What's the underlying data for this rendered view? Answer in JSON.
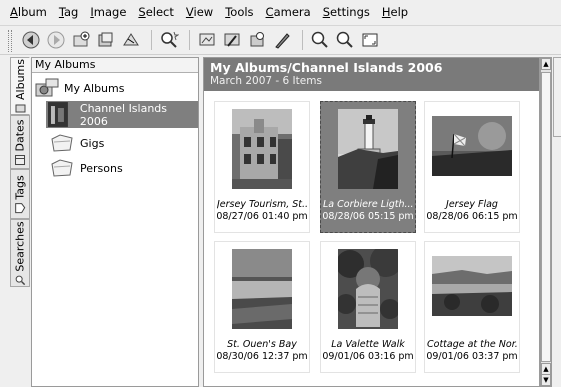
{
  "menubar": {
    "items": [
      "Album",
      "Tag",
      "Image",
      "Select",
      "View",
      "Tools",
      "Camera",
      "Settings",
      "Help"
    ]
  },
  "toolbar": {
    "icons": [
      "back-icon",
      "forward-icon",
      "new-album-icon",
      "add-images-icon",
      "delete-album-icon",
      "search-icon",
      "view-image-icon",
      "edit-image-icon",
      "properties-icon",
      "tag-pen-icon",
      "zoom-in-icon",
      "zoom-out-icon",
      "fullscreen-icon"
    ]
  },
  "sidebar": {
    "tabs": [
      "Albums",
      "Dates",
      "Tags",
      "Searches"
    ],
    "active_tab": "Albums"
  },
  "tree": {
    "header": "My Albums",
    "root": "My Albums",
    "items": [
      "Channel Islands 2006",
      "Gigs",
      "Persons"
    ],
    "selected": "Channel Islands 2006"
  },
  "main": {
    "title": "My Albums/Channel Islands 2006",
    "subtitle": "March 2007 - 6 Items",
    "thumbnails": [
      {
        "caption": "Jersey Tourism, St...",
        "date": "08/27/06 01:40 pm",
        "selected": false
      },
      {
        "caption": "La Corbiere Ligth...",
        "date": "08/28/06 05:15 pm",
        "selected": true
      },
      {
        "caption": "Jersey Flag",
        "date": "08/28/06 06:15 pm",
        "selected": false
      },
      {
        "caption": "St. Ouen's Bay",
        "date": "08/30/06 12:37 pm",
        "selected": false
      },
      {
        "caption": "La Valette Walk",
        "date": "09/01/06 03:16 pm",
        "selected": false
      },
      {
        "caption": "Cottage at the Nor...",
        "date": "09/01/06 03:37 pm",
        "selected": false
      }
    ]
  }
}
